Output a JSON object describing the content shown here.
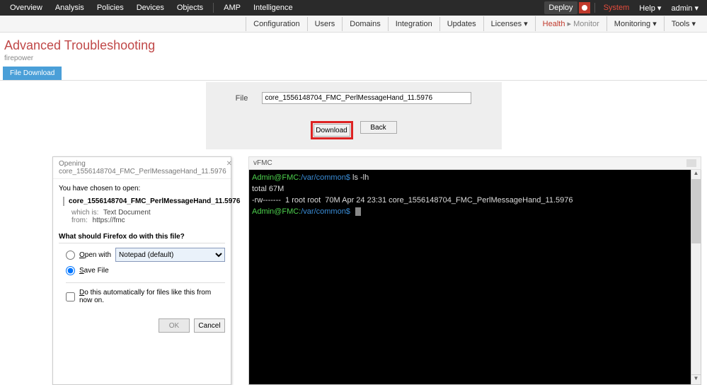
{
  "topnav": {
    "left": [
      "Overview",
      "Analysis",
      "Policies",
      "Devices",
      "Objects",
      "AMP",
      "Intelligence"
    ],
    "deploy": "Deploy",
    "system": "System",
    "help": "Help ▾",
    "admin": "admin ▾"
  },
  "secnav": {
    "items": [
      "Configuration",
      "Users",
      "Domains",
      "Integration",
      "Updates",
      "Licenses ▾"
    ],
    "health": "Health",
    "health_sub": "▸ Monitor",
    "rest": [
      "Monitoring ▾",
      "Tools ▾"
    ]
  },
  "page": {
    "title": "Advanced Troubleshooting",
    "subtitle": "firepower"
  },
  "tab": {
    "label": "File Download"
  },
  "file_panel": {
    "label": "File",
    "value": "core_1556148704_FMC_PerlMessageHand_11.5976",
    "download": "Download",
    "back": "Back"
  },
  "dialog": {
    "title": "Opening core_1556148704_FMC_PerlMessageHand_11.5976",
    "chosen": "You have chosen to open:",
    "filename": "core_1556148704_FMC_PerlMessageHand_11.5976",
    "which_is_key": "which is:",
    "which_is_val": "Text Document",
    "from_key": "from:",
    "from_val": "https://fmc",
    "question": "What should Firefox do with this file?",
    "open_with": "pen with",
    "select_val": "Notepad (default)",
    "save_file": "ave File",
    "auto": "o this automatically for files like this from now on.",
    "ok": "OK",
    "cancel": "Cancel"
  },
  "terminal": {
    "title": "vFMC",
    "prompt_user": "Admin@FMC:",
    "prompt_path": "/var/common$",
    "cmd": " ls -lh",
    "total": "total 67M",
    "listing": "-rw-------  1 root root  70M Apr 24 23:31 core_1556148704_FMC_PerlMessageHand_11.5976"
  }
}
